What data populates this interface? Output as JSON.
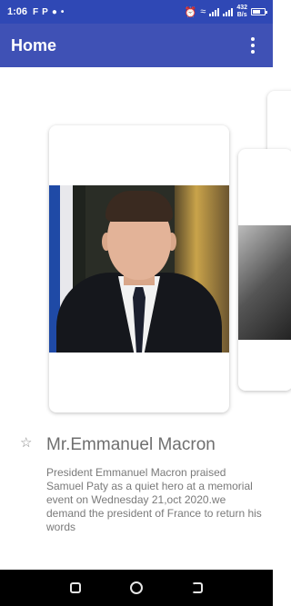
{
  "status_bar": {
    "time": "1:06",
    "notification_letters": [
      "F",
      "P"
    ],
    "network_speed_value": "432",
    "network_speed_unit": "B/s"
  },
  "app_bar": {
    "title": "Home"
  },
  "item": {
    "name": "Mr.Emmanuel Macron",
    "description": "President Emmanuel Macron praised Samuel Paty as a quiet hero at a memorial event on Wednesday 21,oct 2020.we demand the president of France to return his words"
  },
  "colors": {
    "status_bar": "#2f48b5",
    "app_bar": "#3f51b5",
    "nav_bar": "#000000"
  }
}
